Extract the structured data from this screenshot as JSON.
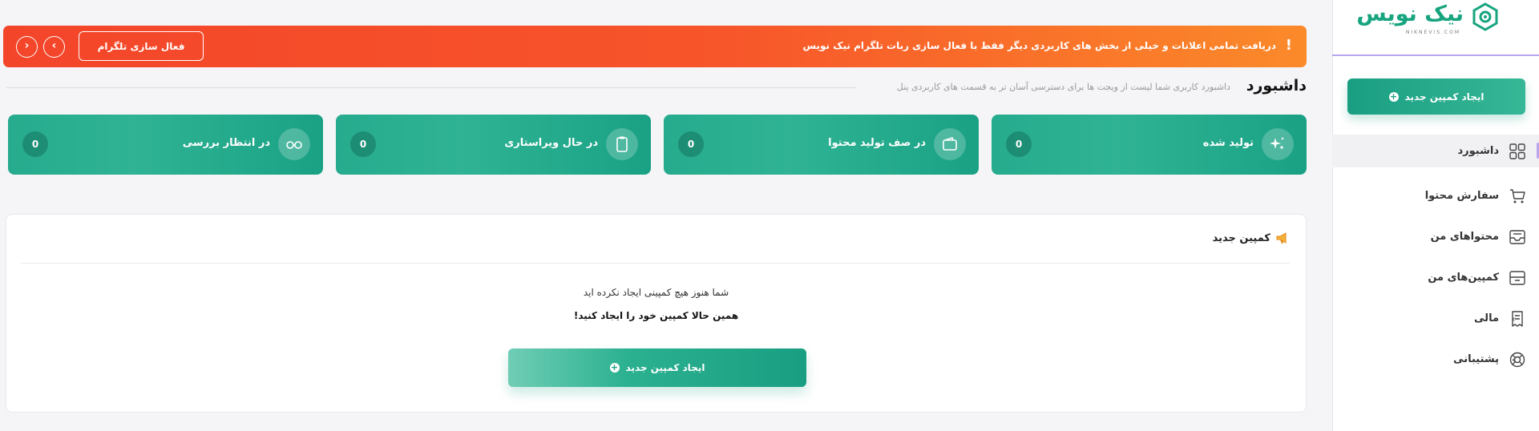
{
  "sidebar": {
    "logo_text": "نیک نویس",
    "logo_sub": "NIKNEVIS.COM",
    "cta_label": "ایجاد کمپین جدید",
    "items": [
      {
        "label": "داشبورد",
        "icon": "grid-icon"
      },
      {
        "label": "سفارش محتوا",
        "icon": "cart-icon"
      },
      {
        "label": "محتواهای من",
        "icon": "inbox-icon"
      },
      {
        "label": "کمپین‌های من",
        "icon": "archive-icon"
      },
      {
        "label": "مالی",
        "icon": "receipt-icon",
        "chevron": "›"
      },
      {
        "label": "پشتیبانی",
        "icon": "lifebuoy-icon",
        "chevron": "›"
      }
    ]
  },
  "banner": {
    "bang": "!",
    "text": "دریافت تمامی اعلانات و خیلی از بخش های کاربردی دیگر فقط با فعال سازی ربات تلگرام نیک نویس",
    "button_label": "فعال سازی تلگرام",
    "arrow_prev": "›",
    "arrow_next": "‹"
  },
  "header": {
    "title": "داشبورد",
    "subtitle": "داشبورد کاربری شما لیست از ویجت ها برای دسترسی آسان تر به قسمت های کاربردی پنل"
  },
  "stats": [
    {
      "label": "تولید شده",
      "count": "0",
      "icon": "sparkle-icon"
    },
    {
      "label": "در صف تولید محتوا",
      "count": "0",
      "icon": "wallet-icon"
    },
    {
      "label": "در حال ویراستاری",
      "count": "0",
      "icon": "clipboard-icon"
    },
    {
      "label": "در انتظار بررسی",
      "count": "0",
      "icon": "glasses-icon"
    }
  ],
  "campaign_panel": {
    "title": "کمپین جدید",
    "empty_line1": "شما هنوز هیچ کمپینی ایجاد نکرده اید",
    "empty_line2": "همین حالا کمپین خود را ایجاد کنید!",
    "cta_label": "ایجاد کمپین جدید"
  },
  "colors": {
    "brand_green": "#1a9e82",
    "banner_orange": "#f7552a",
    "accent_purple": "#b9a6ef"
  }
}
